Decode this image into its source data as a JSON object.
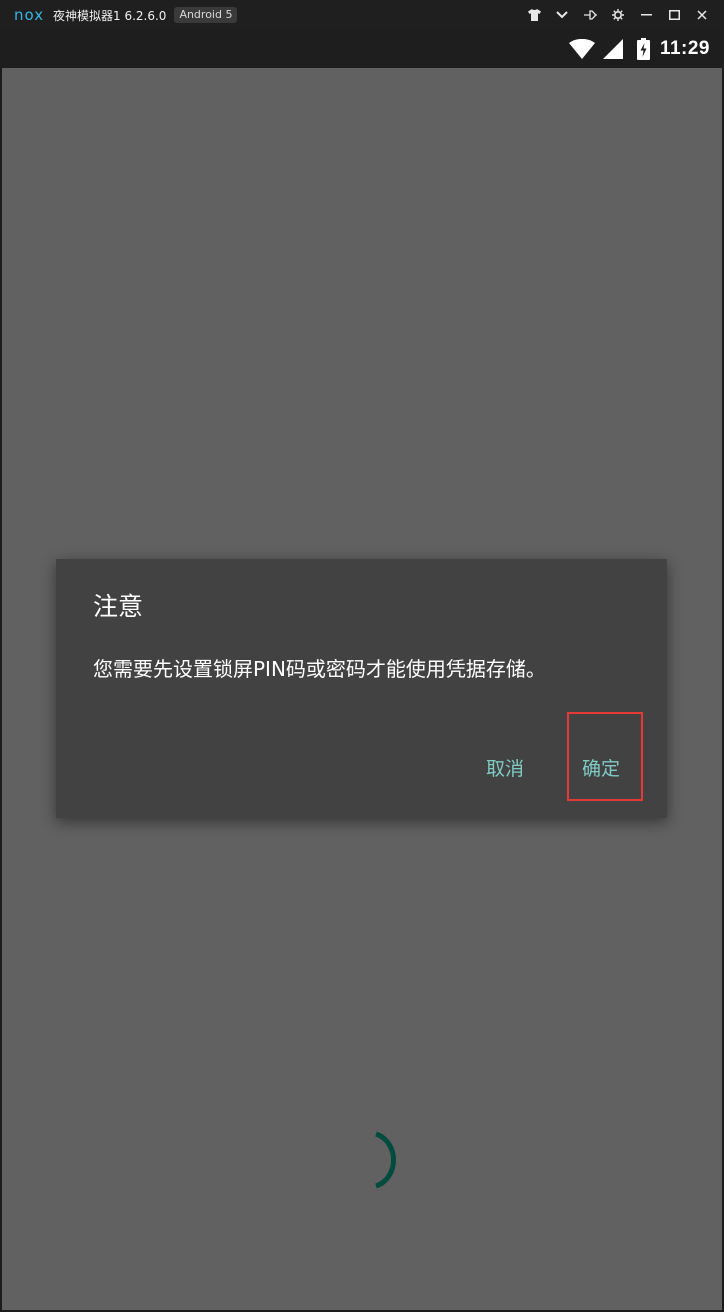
{
  "emulator": {
    "logo": "nox",
    "title": "夜神模拟器1 6.2.6.0",
    "android_badge": "Android 5",
    "controls": [
      "shirt-icon",
      "chevron-down-icon",
      "pin-icon",
      "gear-icon",
      "minimize-icon",
      "maximize-icon",
      "close-icon"
    ]
  },
  "status_bar": {
    "time": "11:29",
    "icons": [
      "wifi-icon",
      "signal-icon",
      "battery-charging-icon"
    ]
  },
  "dialog": {
    "title": "注意",
    "message": "您需要先设置锁屏PIN码或密码才能使用凭据存储。",
    "cancel_label": "取消",
    "ok_label": "确定"
  },
  "colors": {
    "accent": "#80cbc4",
    "dialog_bg": "#424242",
    "scrim": "#616161",
    "highlight": "#e53935",
    "spinner": "#004d40",
    "logo": "#35b6e6"
  }
}
